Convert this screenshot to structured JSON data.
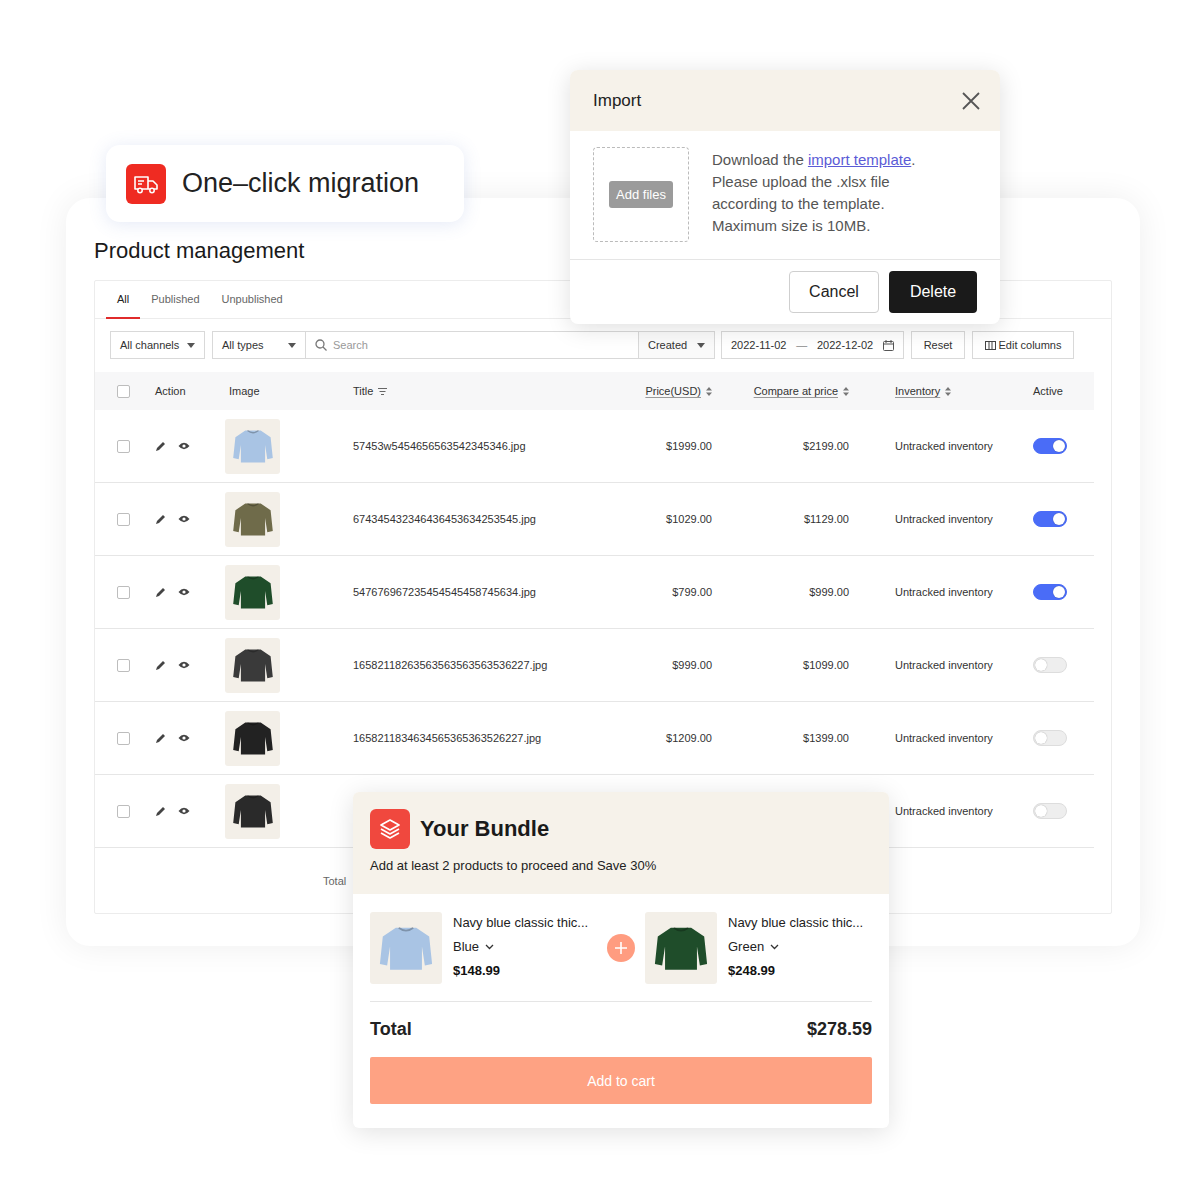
{
  "badge": {
    "label": "One–click migration"
  },
  "page": {
    "title": "Product management"
  },
  "tabs": [
    {
      "label": "All",
      "selected": true
    },
    {
      "label": "Published",
      "selected": false
    },
    {
      "label": "Unpublished",
      "selected": false
    }
  ],
  "filters": {
    "channel": "All channels",
    "type": "All types",
    "search_placeholder": "Search",
    "sort": "Created",
    "date_from": "2022-11-02",
    "date_separator": "—",
    "date_to": "2022-12-02",
    "reset": "Reset",
    "edit_columns": "Edit columns"
  },
  "table": {
    "select_all_checked": false,
    "columns": [
      {
        "label": "Action",
        "kind": "plain"
      },
      {
        "label": "Image",
        "kind": "plain"
      },
      {
        "label": "Title",
        "kind": "filter"
      },
      {
        "label": "Price(USD)",
        "kind": "sort"
      },
      {
        "label": "Compare at price",
        "kind": "sort"
      },
      {
        "label": "Inventory",
        "kind": "sort"
      },
      {
        "label": "Active",
        "kind": "plain"
      }
    ],
    "rows": [
      {
        "checked": false,
        "color": "#a9c4e4",
        "title": "57453w5454656563542345346.jpg",
        "price": "$1999.00",
        "compare": "$2199.00",
        "inventory": "Untracked inventory",
        "active": true
      },
      {
        "checked": false,
        "color": "#6f6b4a",
        "title": "674345432346436453634253545.jpg",
        "price": "$1029.00",
        "compare": "$1129.00",
        "inventory": "Untracked inventory",
        "active": true
      },
      {
        "checked": false,
        "color": "#1f4d2a",
        "title": "547676967235454545458745634.jpg",
        "price": "$799.00",
        "compare": "$999.00",
        "inventory": "Untracked inventory",
        "active": true
      },
      {
        "checked": false,
        "color": "#3a3a3a",
        "title": "16582118263563563563563536227.jpg",
        "price": "$999.00",
        "compare": "$1099.00",
        "inventory": "Untracked inventory",
        "active": false
      },
      {
        "checked": false,
        "color": "#222222",
        "title": "1658211834634565365363526227.jpg",
        "price": "$1209.00",
        "compare": "$1399.00",
        "inventory": "Untracked inventory",
        "active": false
      },
      {
        "checked": false,
        "color": "#2a2a2a",
        "inventory": "Untracked inventory",
        "active": false
      }
    ]
  },
  "footer": {
    "total": "Total"
  },
  "import_dialog": {
    "title": "Import",
    "add_files": "Add files",
    "instruction": {
      "before": "Download the ",
      "link": "import template",
      "after": "."
    },
    "lines": [
      "Please upload the .xlsx file",
      "according to the template.",
      "Maximum size is 10MB."
    ],
    "cancel": "Cancel",
    "delete": "Delete"
  },
  "bundle": {
    "title": "Your Bundle",
    "subtitle": "Add at least 2 products to proceed and Save 30%",
    "items": [
      {
        "name": "Navy blue classic thic...",
        "variant": "Blue",
        "price": "$148.99",
        "color": "#a9c4e4"
      },
      {
        "name": "Navy blue classic thic...",
        "variant": "Green",
        "price": "$248.99",
        "color": "#1f4d2a"
      }
    ],
    "total_label": "Total",
    "total": "$278.59",
    "button": "Add to cart"
  }
}
